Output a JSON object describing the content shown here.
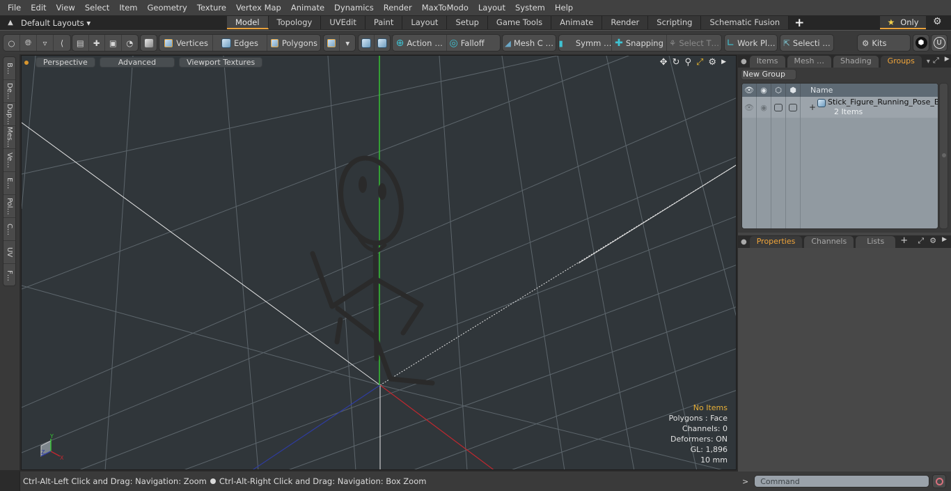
{
  "menu": [
    "File",
    "Edit",
    "View",
    "Select",
    "Item",
    "Geometry",
    "Texture",
    "Vertex Map",
    "Animate",
    "Dynamics",
    "Render",
    "MaxToModo",
    "Layout",
    "System",
    "Help"
  ],
  "layout_bar": {
    "default_layouts": "Default Layouts ▾",
    "tabs": [
      {
        "label": "Model",
        "active": true
      },
      {
        "label": "Topology"
      },
      {
        "label": "UVEdit"
      },
      {
        "label": "Paint"
      },
      {
        "label": "Layout"
      },
      {
        "label": "Setup"
      },
      {
        "label": "Game Tools"
      },
      {
        "label": "Animate"
      },
      {
        "label": "Render"
      },
      {
        "label": "Scripting"
      },
      {
        "label": "Schematic Fusion"
      }
    ],
    "add_tab": "+",
    "only_label": "Only",
    "star": "★"
  },
  "toolbar": {
    "vertices": "Vertices",
    "edges": "Edges",
    "polygons": "Polygons",
    "action": "Action",
    "action_more": "…",
    "falloff": "Falloff",
    "mesh_c": "Mesh C …",
    "symm": "Symm …",
    "snapping": "Snapping",
    "select_t": "Select T…",
    "work_pl": "Work Pl…",
    "selecti": "Selecti …",
    "kits": "Kits"
  },
  "left_palette": [
    "B…",
    "De…",
    "Dup…",
    "Mes…",
    "Ve…",
    "E…",
    "Pol…",
    "C…",
    "UV",
    "F…"
  ],
  "viewport": {
    "buttons": [
      "Perspective",
      "Advanced",
      "Viewport Textures"
    ],
    "hud": {
      "selection": "No Items",
      "polygons": "Polygons : Face",
      "channels": "Channels: 0",
      "deformers": "Deformers: ON",
      "gl": "GL: 1,896",
      "units": "10 mm"
    },
    "axis_labels": {
      "x": "X",
      "y": "Y",
      "z": "Z"
    }
  },
  "statusbar": {
    "hint1": "Ctrl-Alt-Left Click and Drag: Navigation: Zoom",
    "hint2": "Ctrl-Alt-Right Click and Drag: Navigation: Box Zoom"
  },
  "groups_panel": {
    "tabs": [
      {
        "label": "Items"
      },
      {
        "label": "Mesh …"
      },
      {
        "label": "Shading"
      },
      {
        "label": "Groups",
        "active": true
      }
    ],
    "new_group": "New Group",
    "columns": {
      "name": "Name"
    },
    "rows": [
      {
        "name": "Stick_Figure_Running_Pose_B…",
        "sub": "2 Items",
        "expand": "+"
      }
    ]
  },
  "properties_panel": {
    "tabs": [
      {
        "label": "Properties",
        "active": true
      },
      {
        "label": "Channels"
      },
      {
        "label": "Lists"
      }
    ],
    "add_tab": "+"
  },
  "command": {
    "prompt": ">",
    "placeholder": "Command"
  },
  "colors": {
    "accent": "#e9a23b",
    "x_axis": "#c0282f",
    "y_axis": "#35c232",
    "z_axis": "#2e3ca0",
    "hud_selection": "#e8b037"
  }
}
